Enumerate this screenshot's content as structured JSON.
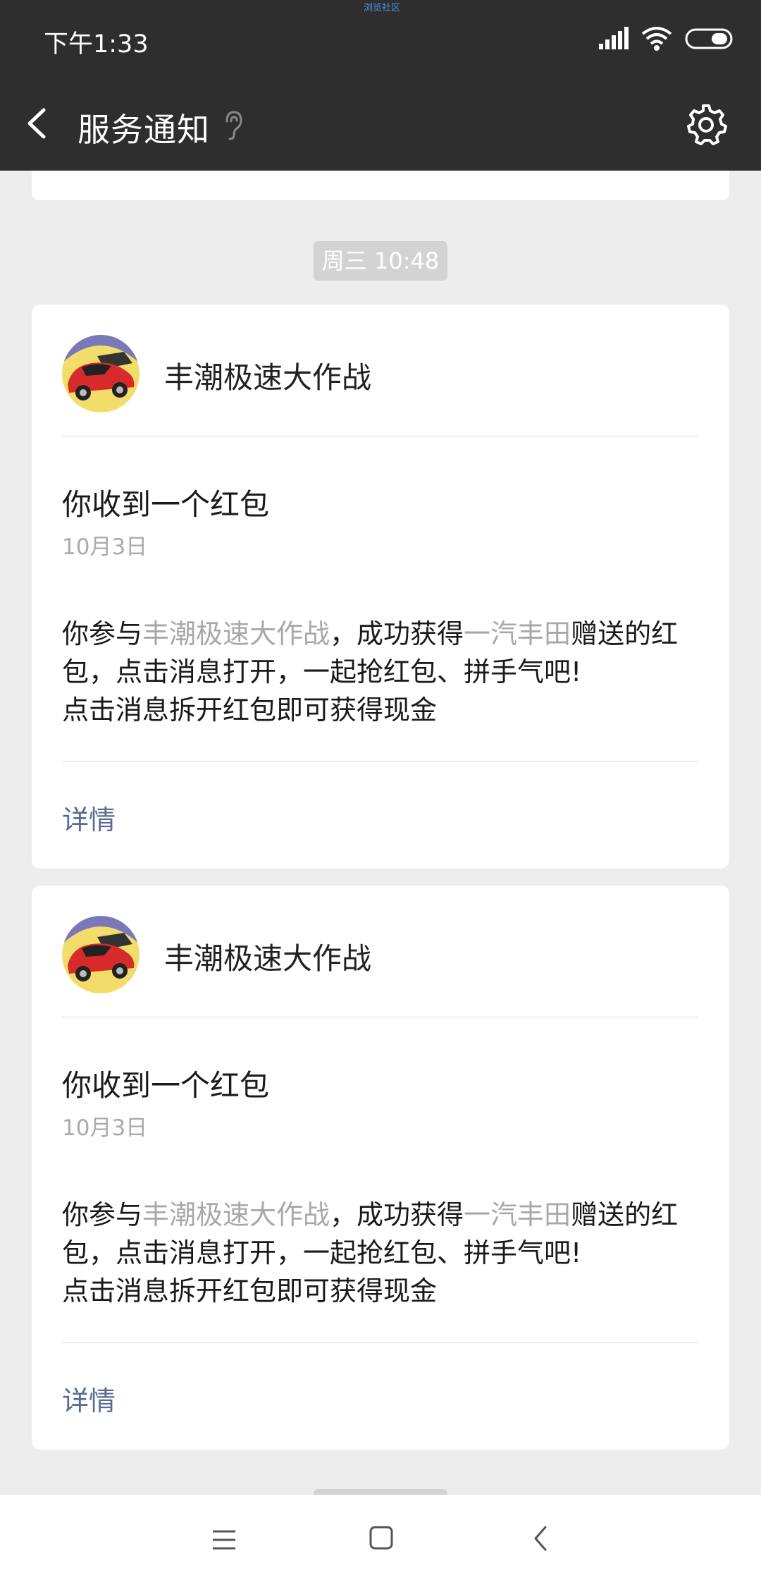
{
  "status_bar": {
    "time": "下午1:33",
    "center_text": "浏览社区"
  },
  "header": {
    "title": "服务通知",
    "icons": [
      "back-arrow-icon",
      "ear-icon",
      "gear-icon"
    ]
  },
  "timestamp_pill": "周三 10:48",
  "cards": [
    {
      "sender": "丰潮极速大作战",
      "title": "你收到一个红包",
      "date": "10月3日",
      "body_1": "你参与",
      "highlight_1": "丰潮极速大作战",
      "body_2": "，成功获得",
      "highlight_2": "一汽丰田",
      "body_3": "赠送的红包，点击消息打开，一起抢红包、拼手气吧!",
      "body_4": "点击消息拆开红包即可获得现金",
      "link": "详情"
    },
    {
      "sender": "丰潮极速大作战",
      "title": "你收到一个红包",
      "date": "10月3日",
      "body_1": "你参与",
      "highlight_1": "丰潮极速大作战",
      "body_2": "，成功获得",
      "highlight_2": "一汽丰田",
      "body_3": "赠送的红包，点击消息打开，一起抢红包、拼手气吧!",
      "body_4": "点击消息拆开红包即可获得现金",
      "link": "详情"
    }
  ],
  "colors": {
    "bar_bg": "#2e2e2e",
    "page_bg": "#ededed",
    "link": "#576b95",
    "highlight": "#a8a8a8"
  }
}
